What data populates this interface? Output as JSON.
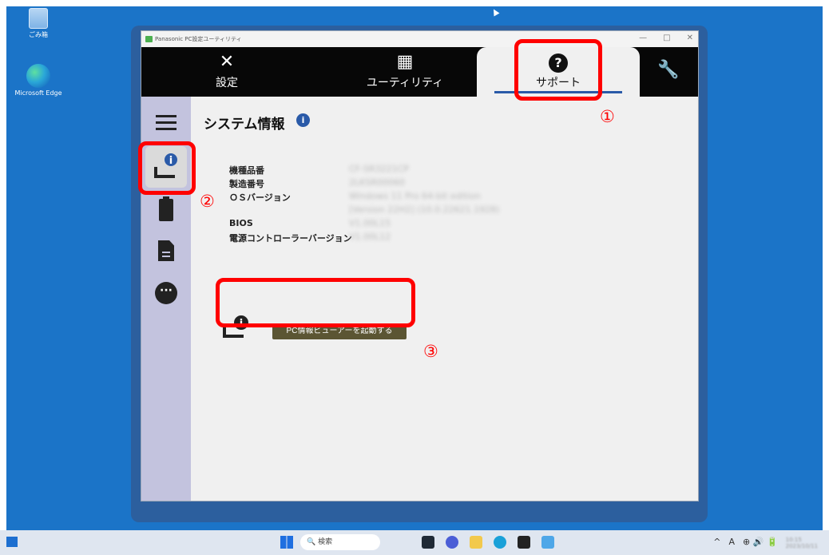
{
  "desktop": {
    "icons": [
      {
        "label": "ごみ箱"
      },
      {
        "label": "Microsoft Edge"
      }
    ]
  },
  "window": {
    "title": "Panasonic PC設定ユーティリティ",
    "controls": {
      "minimize": "—",
      "maximize": "□",
      "close": "✕"
    }
  },
  "tabs": [
    {
      "label": "設定",
      "icon": "tools-icon"
    },
    {
      "label": "ユーティリティ",
      "icon": "grid-icon"
    },
    {
      "label": "サポート",
      "icon": "question-icon",
      "active": true
    },
    {
      "label": "",
      "icon": "wrench-icon"
    }
  ],
  "sidebar": {
    "items": [
      "menu-icon",
      "system-info-icon",
      "battery-icon",
      "document-icon",
      "chat-icon"
    ]
  },
  "content": {
    "title": "システム情報",
    "info_rows": [
      {
        "label": "機種品番",
        "value": "CF-SR3221CP"
      },
      {
        "label": "製造番号",
        "value": "2LKSR00060"
      },
      {
        "label": "ＯＳバージョン",
        "value": "Windows 11 Pro 64-bit edition"
      },
      {
        "label": "",
        "value": "[Version 22H2] (10.0.22621.1928)"
      },
      {
        "label": "BIOS",
        "value": "V1.00L15"
      },
      {
        "label": "電源コントローラーバージョン",
        "value": "V1.00L12"
      }
    ],
    "launch_button": "PC情報ビューアーを起動する"
  },
  "annotations": {
    "marker_1": "①",
    "marker_2": "②",
    "marker_3": "③",
    "color": "#ff0000"
  },
  "taskbar": {
    "search_placeholder": "検索",
    "tray": [
      "^",
      "A",
      "⊕ 🔊 🔋"
    ],
    "time": "10:15",
    "date": "2023/10/11"
  },
  "colors": {
    "desktop": "#1b74c8",
    "tab_bar": "#070707",
    "sidebar": "#c3c3de",
    "accent": "#2a5aa8",
    "button": "#5b5533"
  }
}
